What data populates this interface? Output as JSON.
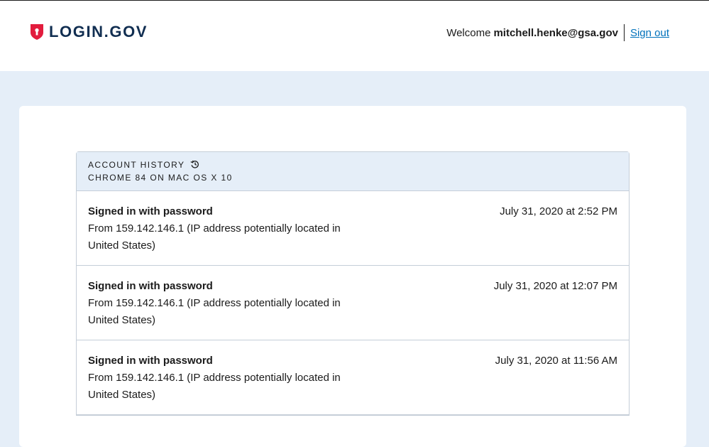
{
  "header": {
    "logo_text": "LOGIN.GOV",
    "welcome_label": "Welcome",
    "user_email": "mitchell.henke@gsa.gov",
    "sign_out_label": "Sign out"
  },
  "history": {
    "title": "ACCOUNT HISTORY",
    "subtitle": "CHROME 84 ON MAC OS X 10",
    "events": [
      {
        "title": "Signed in with password",
        "detail": "From 159.142.146.1 (IP address potentially located in United States)",
        "time": "July 31, 2020 at 2:52 PM"
      },
      {
        "title": "Signed in with password",
        "detail": "From 159.142.146.1 (IP address potentially located in United States)",
        "time": "July 31, 2020 at 12:07 PM"
      },
      {
        "title": "Signed in with password",
        "detail": "From 159.142.146.1 (IP address potentially located in United States)",
        "time": "July 31, 2020 at 11:56 AM"
      }
    ]
  },
  "colors": {
    "brand_red": "#e21c3d",
    "brand_navy": "#112e51",
    "link_blue": "#0071bb",
    "page_background": "#e5eef8"
  },
  "icons": {
    "logo": "shield-lock-icon",
    "history": "history-clock-icon"
  }
}
